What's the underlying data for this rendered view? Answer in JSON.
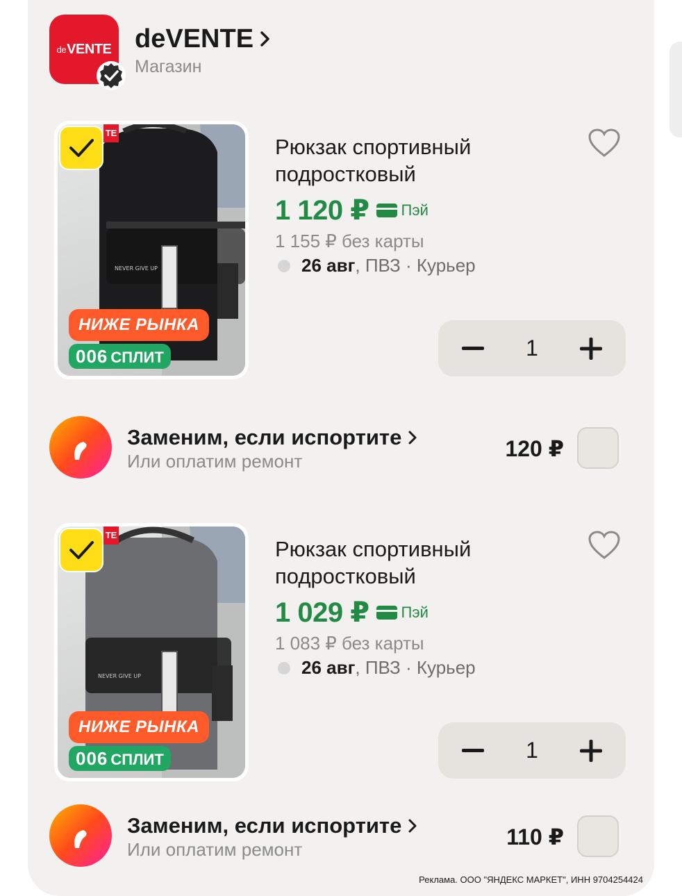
{
  "shop": {
    "logo_small": "de",
    "logo_text": "VENTE",
    "name": "deVENTE",
    "type": "Магазин"
  },
  "products": [
    {
      "title_line1": "Рюкзак спортивный",
      "title_line2": "подростковый",
      "price": "1 120 ₽",
      "pay_label": "Пэй",
      "old_price": "1 155 ₽  без карты",
      "delivery_date": "26 авг",
      "delivery_rest": ", ПВЗ · Курьер",
      "quantity": "1",
      "badge_below": "НИЖЕ РЫНКА",
      "badge_split_num": "006",
      "badge_split_text": "СПЛИТ",
      "brand_tag": "TE",
      "bag_color": "#1c1c1e",
      "selected": true
    },
    {
      "title_line1": "Рюкзак спортивный",
      "title_line2": "подростковый",
      "price": "1 029 ₽",
      "pay_label": "Пэй",
      "old_price": "1 083 ₽  без карты",
      "delivery_date": "26 авг",
      "delivery_rest": ", ПВЗ · Курьер",
      "quantity": "1",
      "badge_below": "НИЖЕ РЫНКА",
      "badge_split_num": "006",
      "badge_split_text": "СПЛИТ",
      "brand_tag": "TE",
      "bag_color": "#6b6d70",
      "selected": true
    }
  ],
  "insurance": [
    {
      "title": "Заменим, если испортите",
      "subtitle": "Или оплатим ремонт",
      "price": "120 ₽"
    },
    {
      "title": "Заменим, если испортите",
      "subtitle": "Или оплатим ремонт",
      "price": "110 ₽"
    }
  ],
  "ad_text": "Реклама. ООО \"ЯНДЕКС МАРКЕТ\", ИНН 9704254424",
  "colors": {
    "price_green": "#238a46",
    "select_yellow": "#ffde17",
    "badge_orange": "#ff5a2a",
    "badge_green": "#21a663",
    "brand_red": "#e3182b"
  }
}
